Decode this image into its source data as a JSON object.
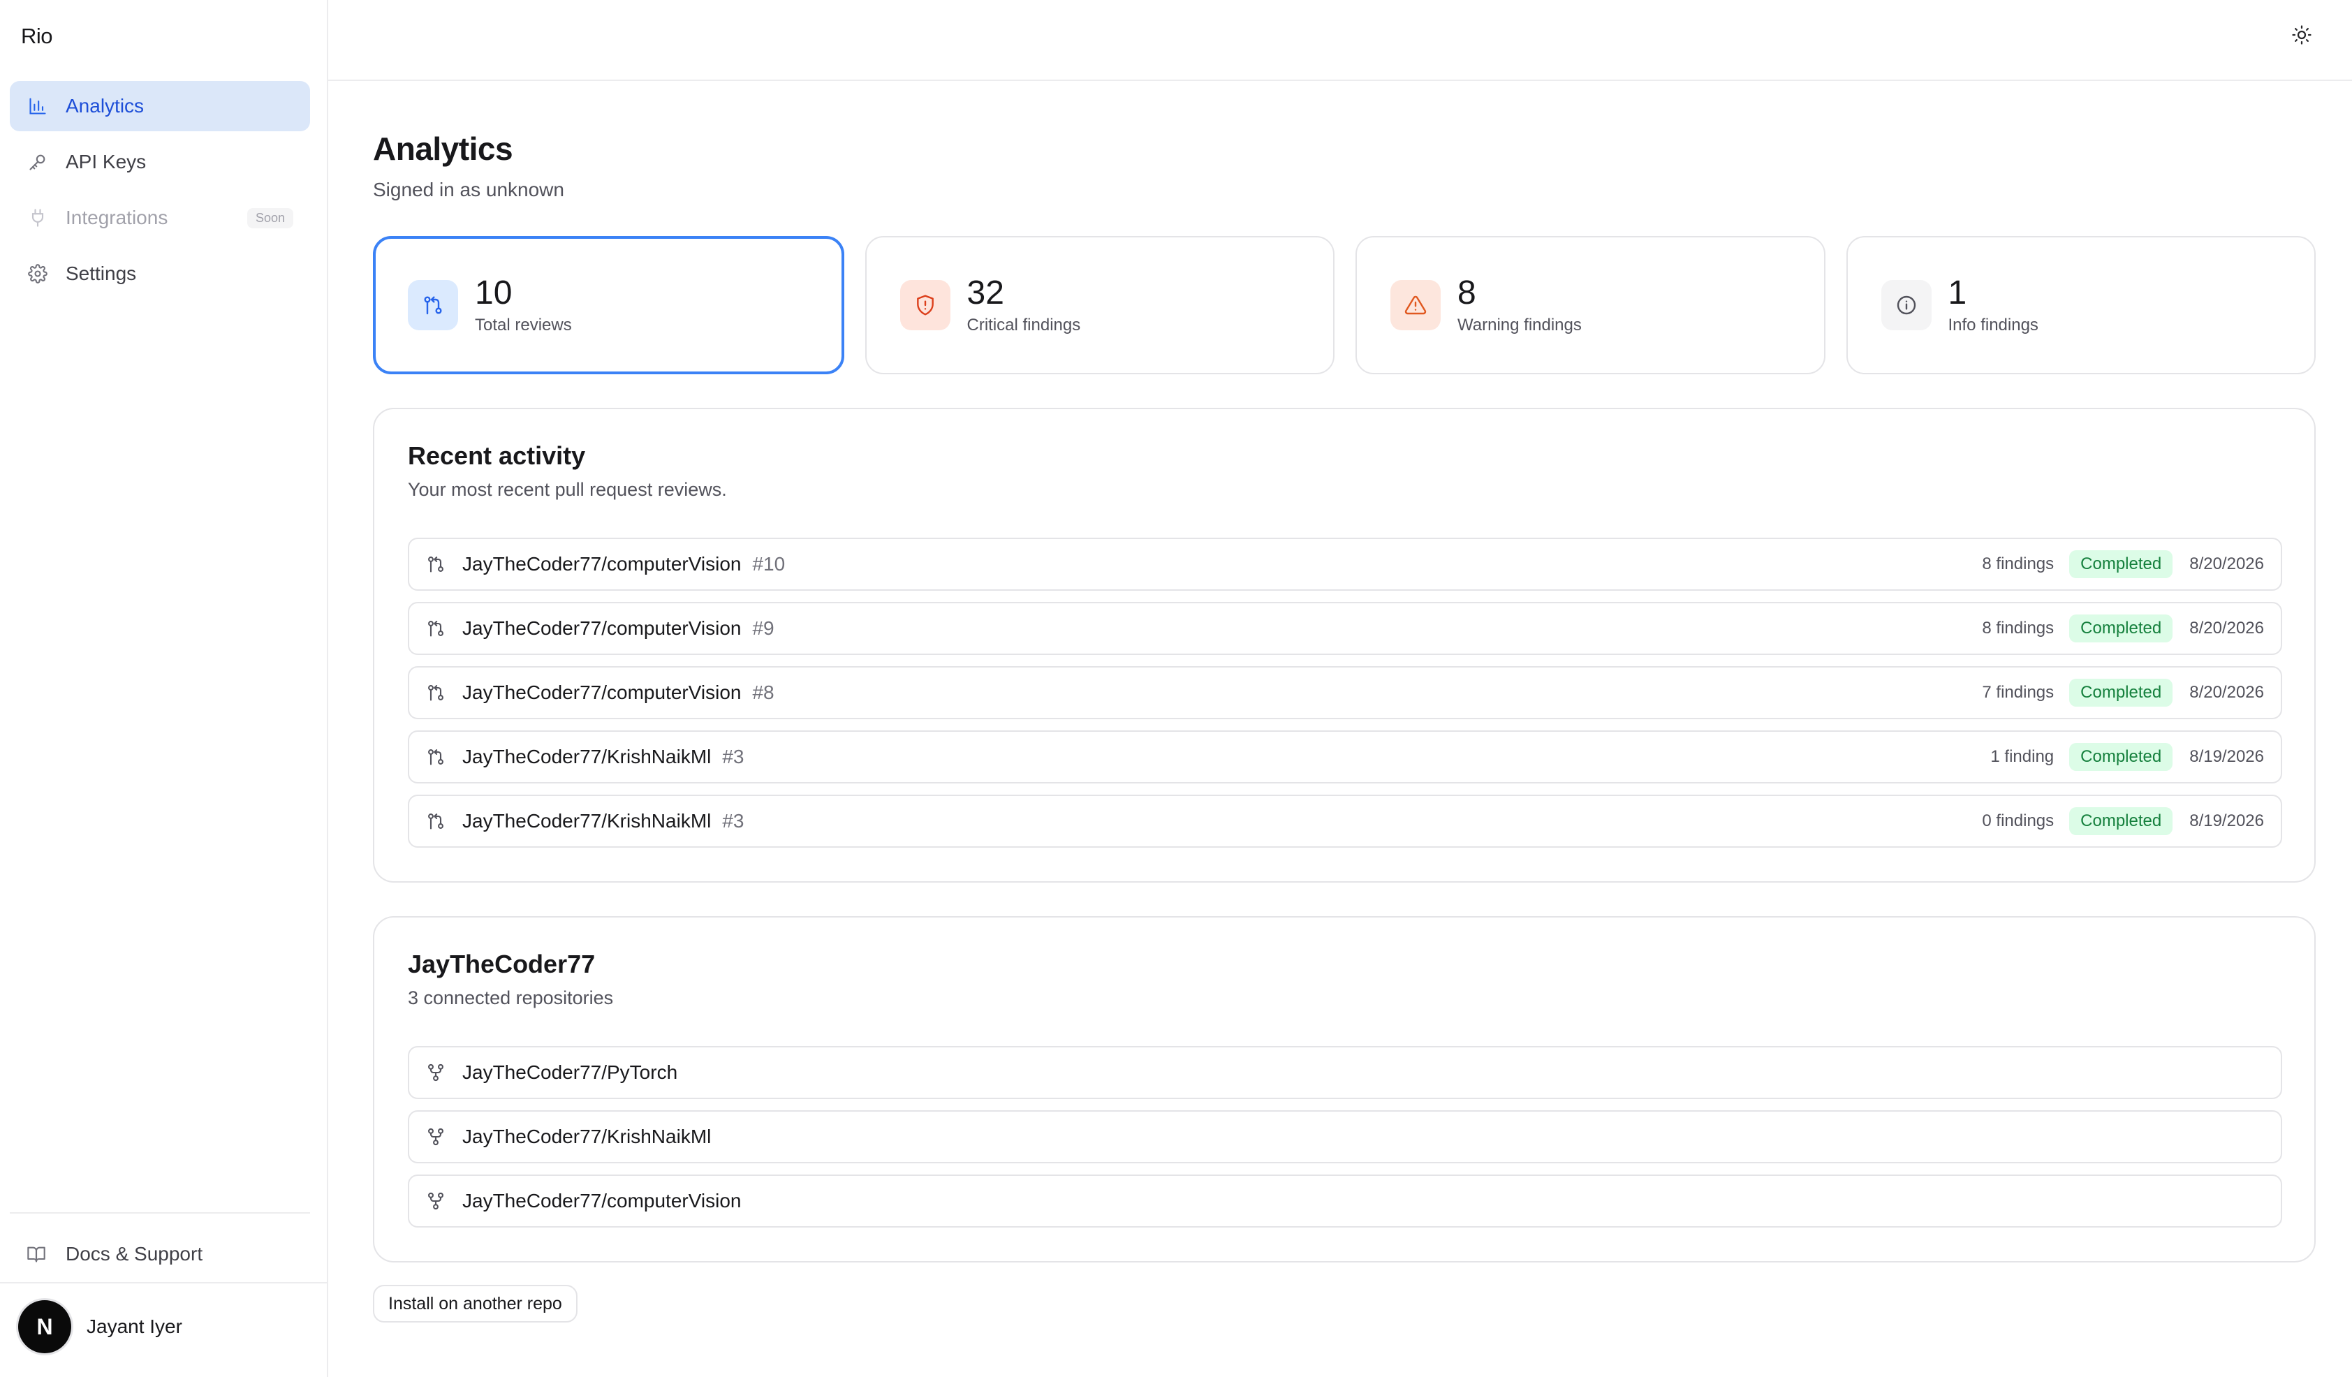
{
  "app": {
    "name": "Rio"
  },
  "sidebar": {
    "items": [
      {
        "label": "Analytics",
        "icon": "bar-chart-icon",
        "active": true
      },
      {
        "label": "API Keys",
        "icon": "key-icon"
      },
      {
        "label": "Integrations",
        "icon": "plug-icon",
        "badge": "Soon",
        "disabled": true
      },
      {
        "label": "Settings",
        "icon": "gear-icon"
      }
    ],
    "docs_label": "Docs & Support",
    "user": {
      "initial": "N",
      "name": "Jayant Iyer"
    }
  },
  "header": {
    "theme_icon": "sun-icon"
  },
  "page": {
    "title": "Analytics",
    "subtitle": "Signed in as unknown"
  },
  "stats": [
    {
      "value": "10",
      "label": "Total reviews",
      "icon": "git-pull-request-icon",
      "color": "#2563eb"
    },
    {
      "value": "32",
      "label": "Critical findings",
      "icon": "shield-alert-icon",
      "color": "#dc3f1b"
    },
    {
      "value": "8",
      "label": "Warning findings",
      "icon": "warning-triangle-icon",
      "color": "#e0581f"
    },
    {
      "value": "1",
      "label": "Info findings",
      "icon": "info-icon",
      "color": "#52525b"
    }
  ],
  "activity": {
    "title": "Recent activity",
    "subtitle": "Your most recent pull request reviews.",
    "rows": [
      {
        "repo": "JayTheCoder77/computerVision",
        "pr": "#10",
        "findings": "8 findings",
        "status": "Completed",
        "date": "8/20/2026"
      },
      {
        "repo": "JayTheCoder77/computerVision",
        "pr": "#9",
        "findings": "8 findings",
        "status": "Completed",
        "date": "8/20/2026"
      },
      {
        "repo": "JayTheCoder77/computerVision",
        "pr": "#8",
        "findings": "7 findings",
        "status": "Completed",
        "date": "8/20/2026"
      },
      {
        "repo": "JayTheCoder77/KrishNaikMl",
        "pr": "#3",
        "findings": "1 finding",
        "status": "Completed",
        "date": "8/19/2026"
      },
      {
        "repo": "JayTheCoder77/KrishNaikMl",
        "pr": "#3",
        "findings": "0 findings",
        "status": "Completed",
        "date": "8/19/2026"
      }
    ]
  },
  "repos": {
    "title": "JayTheCoder77",
    "subtitle": "3 connected repositories",
    "items": [
      {
        "name": "JayTheCoder77/PyTorch"
      },
      {
        "name": "JayTheCoder77/KrishNaikMl"
      },
      {
        "name": "JayTheCoder77/computerVision"
      }
    ]
  },
  "install_label": "Install on another repo",
  "colors": {
    "accent": "#2563eb",
    "status_completed": "#15803d",
    "active_nav_bg": "#dbe7f9"
  }
}
